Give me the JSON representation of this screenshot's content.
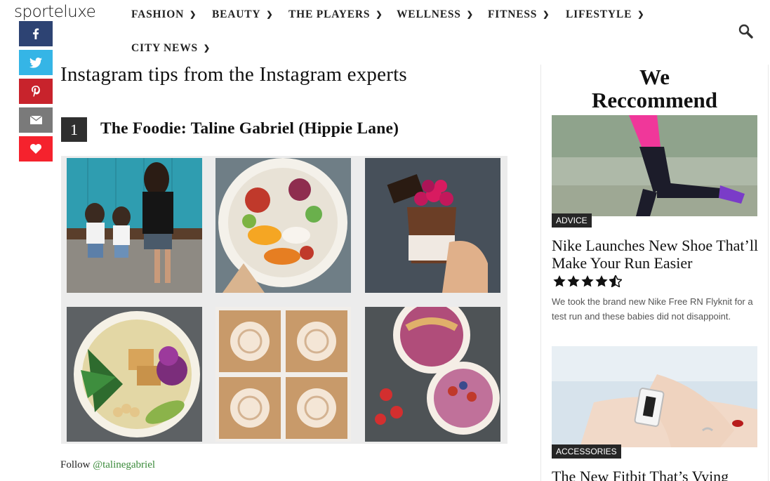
{
  "site": {
    "logo_text": "sporteluxe"
  },
  "nav": {
    "items": [
      {
        "label": "FASHION"
      },
      {
        "label": "BEAUTY"
      },
      {
        "label": "THE PLAYERS"
      },
      {
        "label": "WELLNESS"
      },
      {
        "label": "FITNESS"
      },
      {
        "label": "LIFESTYLE"
      },
      {
        "label": "CITY NEWS"
      }
    ],
    "search_icon": "search-icon"
  },
  "share_bar": {
    "buttons": [
      {
        "network": "facebook",
        "icon": "facebook-icon",
        "color": "#2d4373"
      },
      {
        "network": "twitter",
        "icon": "twitter-icon",
        "color": "#35b5e6"
      },
      {
        "network": "pinterest",
        "icon": "pinterest-icon",
        "color": "#c8232c"
      },
      {
        "network": "email",
        "icon": "email-icon",
        "color": "#7a7a7a"
      },
      {
        "network": "like",
        "icon": "heart-icon",
        "color": "#f5222d"
      }
    ]
  },
  "article": {
    "title": "Instagram tips from the Instagram experts",
    "entry_number": "1",
    "entry_heading": "The Foodie: Taline Gabriel (Hippie Lane)",
    "follow_prefix": "Follow ",
    "follow_handle": "@talinegabriel"
  },
  "sidebar": {
    "title_line1": "We",
    "title_line2": "Reccommend",
    "cards": [
      {
        "category": "ADVICE",
        "title": "Nike Launches New Shoe That’ll Make Your Run Easier",
        "rating": 4.5,
        "excerpt": "We took the brand new Nike Free RN Flyknit for a test run and these babies did not disappoint."
      },
      {
        "category": "ACCESSORIES",
        "title": "The New Fitbit That’s Vying"
      }
    ]
  },
  "colors": {
    "accent_link": "#3a8a3a",
    "badge_bg": "#262626"
  }
}
